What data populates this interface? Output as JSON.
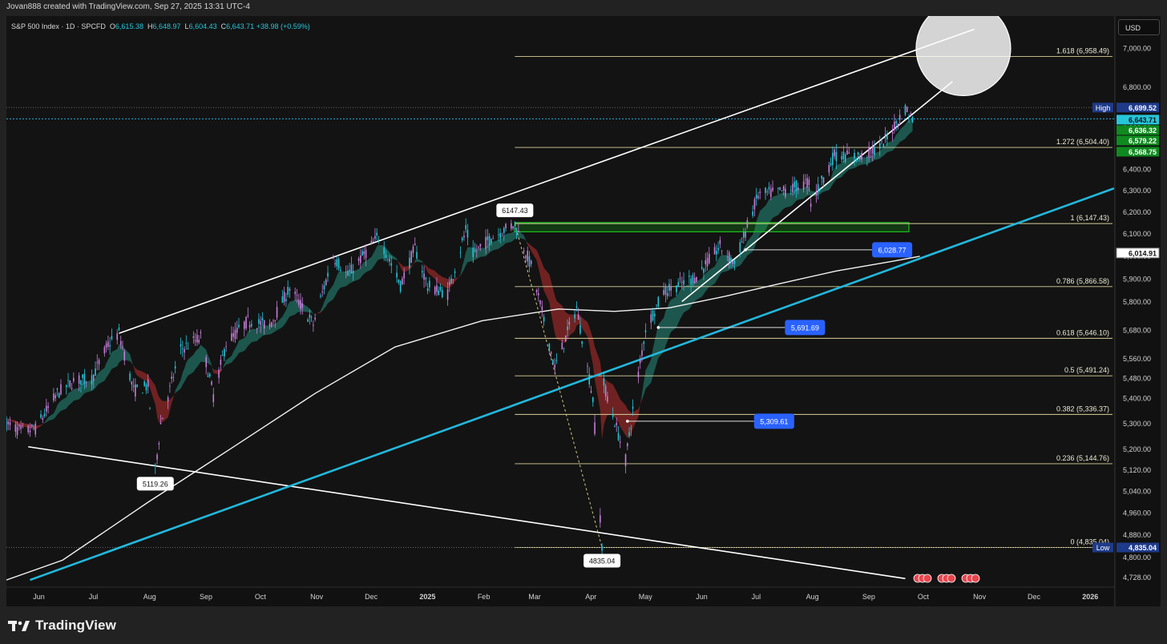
{
  "header": {
    "credit": "Jovan888 created with TradingView.com, Sep 27, 2025 13:31 UTC-4"
  },
  "symbol_line": {
    "name": "S&P 500 Index · 1D · SPCFD",
    "open_label": "O",
    "open": "6,615.38",
    "high_label": "H",
    "high": "6,648.97",
    "low_label": "L",
    "low": "6,604.43",
    "close_label": "C",
    "close": "6,643.71",
    "change": "+38.98 (+0.59%)"
  },
  "currency_button": "USD",
  "brand": {
    "name": "TradingView"
  },
  "colors": {
    "background": "#131313",
    "up_candle": "#26c6da",
    "down_candle": "#c77ddb",
    "fib": "#d9d19a",
    "cyan_trend": "#22b8dc",
    "ribbon_up": "#1f5e54",
    "ribbon_down": "#7a2523",
    "green_zone": "#19c21d",
    "price_line": "#29a9e0"
  },
  "chart_data": {
    "type": "candlestick",
    "title": "S&P 500 Index · 1D · SPCFD",
    "x_axis": {
      "ticks": [
        "Jun",
        "Jul",
        "Aug",
        "Sep",
        "Oct",
        "Nov",
        "Dec",
        "2025",
        "Feb",
        "Mar",
        "Apr",
        "May",
        "Jun",
        "Jul",
        "Aug",
        "Sep",
        "Oct",
        "Nov",
        "Dec",
        "2026"
      ],
      "range": [
        "2024-05-15",
        "2026-01-15"
      ]
    },
    "y_axis": {
      "ticks": [
        4728,
        4800,
        4880,
        4960,
        5040,
        5120,
        5200,
        5300,
        5400,
        5480,
        5560,
        5680,
        5800,
        5900,
        6000,
        6100,
        6200,
        6300,
        6400,
        6600,
        6800,
        7000
      ],
      "tick_labels": [
        "4,728.00",
        "4,800.00",
        "4,880.00",
        "4,960.00",
        "5,040.00",
        "5,120.00",
        "5,200.00",
        "5,300.00",
        "5,400.00",
        "5,480.00",
        "5,560.00",
        "5,680.00",
        "5,800.00",
        "5,900.00",
        "6,000.00",
        "6,100.00",
        "6,200.00",
        "6,300.00",
        "6,400.00",
        "6,600.00",
        "6,800.00",
        "7,000.00"
      ],
      "scale": "log",
      "range": [
        4695,
        7170
      ]
    },
    "price_path": [
      [
        "2024-05-15",
        5300
      ],
      [
        "2024-05-23",
        5270
      ],
      [
        "2024-05-31",
        5280
      ],
      [
        "2024-06-12",
        5420
      ],
      [
        "2024-06-21",
        5470
      ],
      [
        "2024-07-01",
        5480
      ],
      [
        "2024-07-10",
        5620
      ],
      [
        "2024-07-16",
        5667
      ],
      [
        "2024-07-24",
        5430
      ],
      [
        "2024-08-01",
        5450
      ],
      [
        "2024-08-05",
        5119
      ],
      [
        "2024-08-08",
        5300
      ],
      [
        "2024-08-19",
        5600
      ],
      [
        "2024-08-30",
        5650
      ],
      [
        "2024-09-06",
        5410
      ],
      [
        "2024-09-13",
        5626
      ],
      [
        "2024-09-25",
        5720
      ],
      [
        "2024-10-07",
        5700
      ],
      [
        "2024-10-18",
        5860
      ],
      [
        "2024-10-31",
        5705
      ],
      [
        "2024-11-11",
        6000
      ],
      [
        "2024-11-19",
        5916
      ],
      [
        "2024-12-06",
        6090
      ],
      [
        "2024-12-18",
        5872
      ],
      [
        "2024-12-26",
        6037
      ],
      [
        "2025-01-02",
        5868
      ],
      [
        "2025-01-13",
        5836
      ],
      [
        "2025-01-23",
        6118
      ],
      [
        "2025-01-27",
        6012
      ],
      [
        "2025-02-06",
        6083
      ],
      [
        "2025-02-19",
        6147
      ],
      [
        "2025-02-28",
        5955
      ],
      [
        "2025-03-13",
        5522
      ],
      [
        "2025-03-25",
        5776
      ],
      [
        "2025-04-03",
        5396
      ],
      [
        "2025-04-08",
        4835
      ],
      [
        "2025-04-09",
        5456
      ],
      [
        "2025-04-21",
        5158
      ],
      [
        "2025-05-02",
        5687
      ],
      [
        "2025-05-12",
        5844
      ],
      [
        "2025-05-30",
        5911
      ],
      [
        "2025-06-12",
        6045
      ],
      [
        "2025-06-20",
        5967
      ],
      [
        "2025-07-03",
        6279
      ],
      [
        "2025-07-17",
        6297
      ],
      [
        "2025-07-31",
        6339
      ],
      [
        "2025-08-01",
        6238
      ],
      [
        "2025-08-14",
        6468
      ],
      [
        "2025-08-29",
        6460
      ],
      [
        "2025-09-09",
        6512
      ],
      [
        "2025-09-22",
        6693
      ],
      [
        "2025-09-26",
        6643.71
      ]
    ],
    "ma_200": [
      [
        "2024-05-15",
        4720
      ],
      [
        "2024-06-15",
        4790
      ],
      [
        "2024-08-01",
        5000
      ],
      [
        "2024-09-15",
        5200
      ],
      [
        "2024-11-01",
        5420
      ],
      [
        "2024-12-15",
        5610
      ],
      [
        "2025-02-01",
        5720
      ],
      [
        "2025-03-15",
        5770
      ],
      [
        "2025-04-15",
        5760
      ],
      [
        "2025-05-15",
        5775
      ],
      [
        "2025-06-15",
        5825
      ],
      [
        "2025-07-15",
        5880
      ],
      [
        "2025-08-15",
        5935
      ],
      [
        "2025-09-15",
        5978
      ],
      [
        "2025-09-30",
        6000
      ]
    ],
    "key_levels": [
      {
        "label": "6147.43",
        "date": "2025-02-19",
        "value": 6147.43,
        "position": "above"
      },
      {
        "label": "5119.26",
        "date": "2024-08-05",
        "value": 5119.26,
        "position": "below"
      },
      {
        "label": "4835.04",
        "date": "2025-04-08",
        "value": 4835.04,
        "position": "below"
      }
    ],
    "fibonacci": [
      {
        "ratio": "1.618",
        "value": 6958.49,
        "label": "1.618 (6,958.49)"
      },
      {
        "ratio": "1.272",
        "value": 6504.4,
        "label": "1.272 (6,504.40)"
      },
      {
        "ratio": "1",
        "value": 6147.43,
        "label": "1 (6,147.43)"
      },
      {
        "ratio": "0.786",
        "value": 5866.58,
        "label": "0.786 (5,866.58)"
      },
      {
        "ratio": "0.618",
        "value": 5646.1,
        "label": "0.618 (5,646.10)"
      },
      {
        "ratio": "0.5",
        "value": 5491.24,
        "label": "0.5 (5,491.24)"
      },
      {
        "ratio": "0.382",
        "value": 5336.37,
        "label": "0.382 (5,336.37)"
      },
      {
        "ratio": "0.236",
        "value": 5144.76,
        "label": "0.236 (5,144.76)"
      },
      {
        "ratio": "0",
        "value": 4835.04,
        "label": "0 (4,835.04)"
      }
    ],
    "price_labels": [
      {
        "label": "6,028.77",
        "date": "2025-06-26",
        "value": 6028.77
      },
      {
        "label": "5,691.69",
        "date": "2025-05-09",
        "value": 5691.69
      },
      {
        "label": "5,309.61",
        "date": "2025-04-22",
        "value": 5309.61
      }
    ],
    "green_zone": {
      "from": "2025-02-19",
      "to": "2025-10-01",
      "low": 6110,
      "high": 6152
    },
    "trend_lines": [
      {
        "name": "upper-channel",
        "points": [
          [
            "2024-07-16",
            5667
          ],
          [
            "2025-10-30",
            7100
          ]
        ]
      },
      {
        "name": "lower-channel",
        "points": [
          [
            "2024-05-27",
            5210
          ],
          [
            "2025-09-22",
            4725
          ]
        ]
      },
      {
        "name": "cyan-trend",
        "points": [
          [
            "2024-05-28",
            4720
          ],
          [
            "2026-01-15",
            6310
          ]
        ]
      },
      {
        "name": "rising-support",
        "points": [
          [
            "2025-05-22",
            5802
          ],
          [
            "2025-10-18",
            6830
          ]
        ]
      }
    ],
    "target_circle": {
      "date": "2025-10-24",
      "value": 7000
    },
    "axis_badges": [
      {
        "label": "High",
        "value": "6,699.52"
      },
      {
        "label": "",
        "value": "6,643.71"
      },
      {
        "label": "",
        "value": "6,636.32"
      },
      {
        "label": "",
        "value": "6,579.22"
      },
      {
        "label": "",
        "value": "6,568.75"
      },
      {
        "label": "",
        "value": "6,014.91"
      },
      {
        "label": "Low",
        "value": "4,835.04"
      }
    ],
    "high": 6699.52,
    "low": 4835.04,
    "last_price": 6643.71
  }
}
